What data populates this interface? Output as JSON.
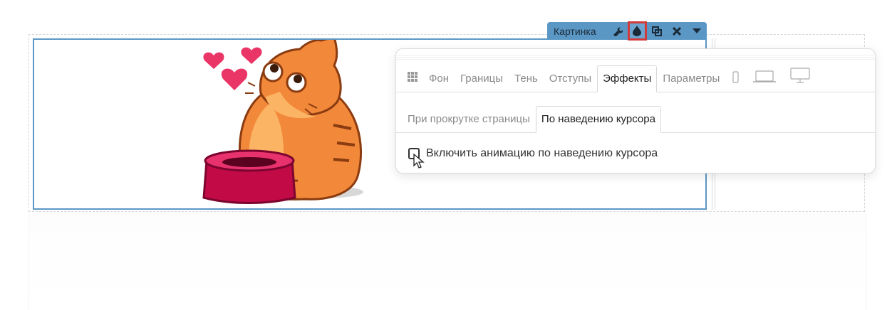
{
  "toolbar": {
    "label": "Картинка",
    "buttons": [
      "wrench-icon",
      "drop-icon",
      "copy-icon",
      "close-icon",
      "caret-down-icon"
    ],
    "active_button": "drop-icon",
    "color": "#5b97c5",
    "highlight_color": "#d23a3a"
  },
  "panel": {
    "tabs": {
      "background": "Фон",
      "borders": "Границы",
      "shadow": "Тень",
      "padding": "Отступы",
      "effects": "Эффекты",
      "params": "Параметры"
    },
    "active_tab": "Эффекты",
    "devices": [
      "phone-icon",
      "laptop-icon",
      "desktop-icon"
    ],
    "subtabs": {
      "scroll": "При прокрутке страницы",
      "hover": "По наведению курсора"
    },
    "active_subtab": "По наведению курсора",
    "hover_option": {
      "label": "Включить анимацию по наведению курсора",
      "checked": false
    }
  },
  "image": {
    "subject": "cat-with-hearts-and-bowl-illustration",
    "colors": {
      "cat": "#f2883a",
      "heart": "#ea3567",
      "bowl": "#c20a46"
    }
  }
}
